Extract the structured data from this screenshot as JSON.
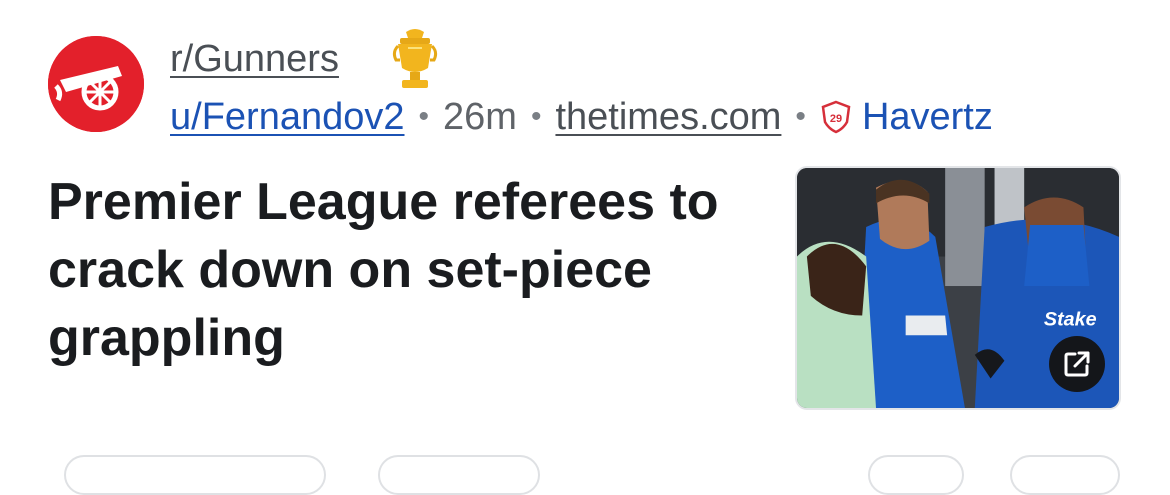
{
  "post": {
    "subreddit": "r/Gunners",
    "author": "u/Fernandov2",
    "time": "26m",
    "separator": "•",
    "domain": "thetimes.com",
    "flair": {
      "number": "29",
      "name": "Havertz"
    },
    "title": "Premier League referees to crack down on set-piece grappling"
  },
  "icons": {
    "subreddit_avatar": "arsenal-cannon-icon",
    "trophy": "premier-league-trophy-icon",
    "flair_badge": "shield-29-icon",
    "external_link": "external-link-icon"
  },
  "colors": {
    "avatar_bg": "#e3202b",
    "link_blue": "#1b52b4",
    "title_text": "#1a1c1f",
    "meta_gray": "#5f6368",
    "trophy_gold": "#f2b51e"
  }
}
